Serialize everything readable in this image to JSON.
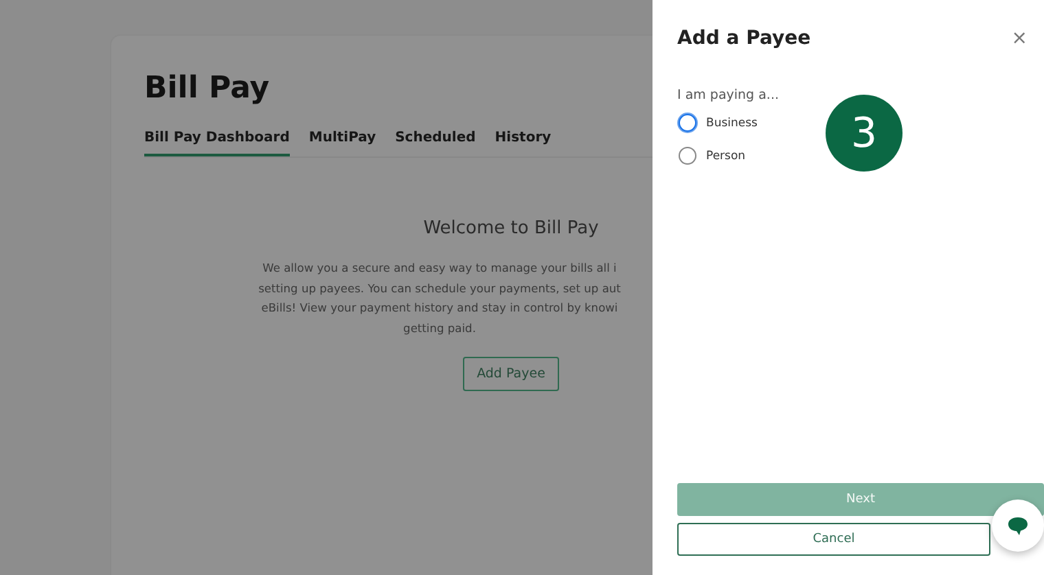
{
  "page": {
    "title": "Bill Pay",
    "tabs": [
      {
        "label": "Bill Pay Dashboard",
        "selected": true
      },
      {
        "label": "MultiPay",
        "selected": false
      },
      {
        "label": "Scheduled",
        "selected": false
      },
      {
        "label": "History",
        "selected": false
      }
    ],
    "welcome": {
      "heading": "Welcome to Bill Pay",
      "lines": [
        "We allow you a secure and easy way to manage your bills all i",
        "setting up payees. You can schedule your payments, set up aut",
        "eBills! View your payment history and stay in control by knowi",
        "getting paid."
      ],
      "button": "Add Payee"
    }
  },
  "panel": {
    "title": "Add a Payee",
    "close": "×",
    "question": "I am paying a...",
    "options": [
      {
        "label": "Business",
        "focused": true
      },
      {
        "label": "Person",
        "focused": false
      }
    ],
    "buttons": [
      {
        "label": "Next",
        "kind": "primary",
        "disabled": true
      },
      {
        "label": "Cancel",
        "kind": "secondary"
      }
    ]
  },
  "step_badge": "3"
}
